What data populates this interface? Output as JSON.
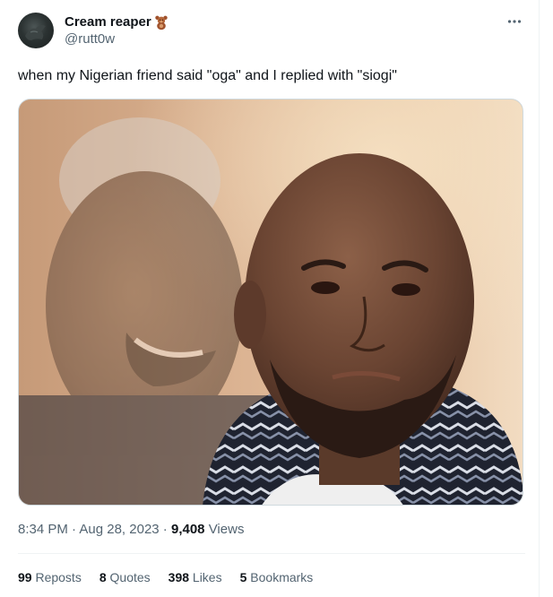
{
  "user": {
    "display_name": "Cream reaper",
    "handle": "@rutt0w",
    "badge_icon": "teddy-bear-emoji"
  },
  "menu": {
    "icon": "more-icon",
    "glyph": "···"
  },
  "tweet": {
    "text": "when my Nigerian friend said \"oga\" and I replied with \"siogi\""
  },
  "meta": {
    "time": "8:34 PM",
    "sep1": " · ",
    "date": "Aug 28, 2023",
    "sep2": " · ",
    "views_count": "9,408",
    "views_label": " Views"
  },
  "stats": {
    "reposts": {
      "count": "99",
      "label": " Reposts"
    },
    "quotes": {
      "count": "8",
      "label": " Quotes"
    },
    "likes": {
      "count": "398",
      "label": " Likes"
    },
    "bookmarks": {
      "count": "5",
      "label": " Bookmarks"
    }
  },
  "colors": {
    "text_primary": "#0f1419",
    "text_secondary": "#536471",
    "border": "#cfd9de"
  }
}
